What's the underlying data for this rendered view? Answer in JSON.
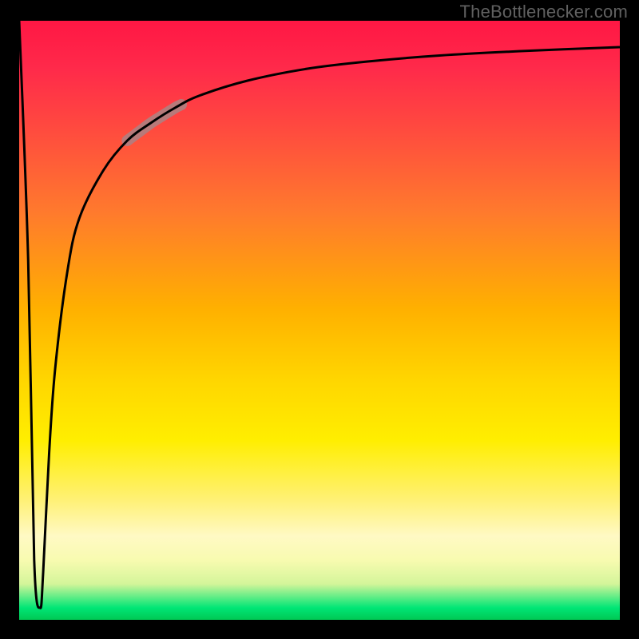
{
  "attribution": "TheBottlenecker.com",
  "chart_data": {
    "type": "line",
    "title": "",
    "xlabel": "",
    "ylabel": "",
    "xlim": [
      0,
      100
    ],
    "ylim": [
      0,
      100
    ],
    "series": [
      {
        "name": "bottleneck-curve",
        "x": [
          0,
          1.5,
          2.5,
          3.5,
          4,
          5,
          6,
          8,
          10,
          14,
          18,
          22,
          26,
          30,
          38,
          48,
          58,
          70,
          85,
          100
        ],
        "values": [
          100,
          60,
          10,
          2,
          8,
          28,
          42,
          58,
          67,
          75,
          80,
          83,
          85.5,
          87.5,
          90,
          92,
          93.2,
          94.2,
          95,
          95.6
        ]
      }
    ],
    "annotations": [
      {
        "name": "highlight-segment",
        "x_start": 18,
        "x_end": 27
      }
    ],
    "background_gradient": {
      "orientation": "vertical",
      "stops": [
        {
          "pos": 0.0,
          "color": "#ff1744"
        },
        {
          "pos": 0.48,
          "color": "#ffd600"
        },
        {
          "pos": 0.86,
          "color": "#fff9c4"
        },
        {
          "pos": 0.98,
          "color": "#00e676"
        },
        {
          "pos": 1.0,
          "color": "#00c853"
        }
      ]
    }
  }
}
